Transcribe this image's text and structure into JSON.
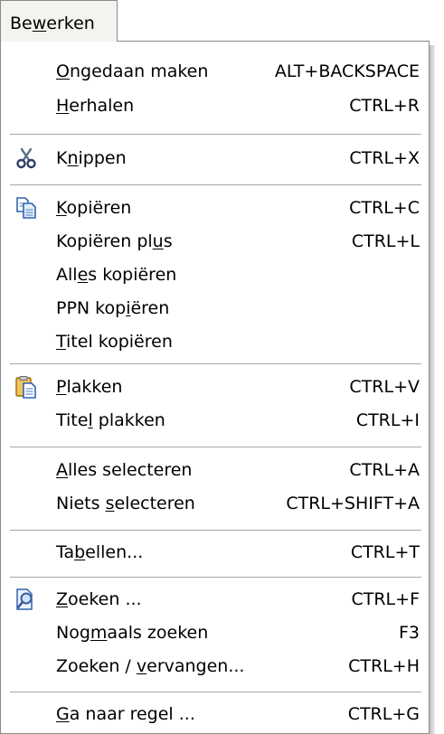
{
  "menubar": {
    "tab_label": "Bewerken"
  },
  "menu": {
    "undo": {
      "label": "Ongedaan maken",
      "shortcut": "ALT+BACKSPACE"
    },
    "redo": {
      "label": "Herhalen",
      "shortcut": "CTRL+R"
    },
    "cut": {
      "label": "Knippen",
      "shortcut": "CTRL+X",
      "icon": "scissors-icon"
    },
    "copy": {
      "label": "Kopiëren",
      "shortcut": "CTRL+C",
      "icon": "copy-icon"
    },
    "copy_plus": {
      "label": "Kopiëren plus",
      "shortcut": "CTRL+L"
    },
    "copy_all": {
      "label": "Alles kopiëren"
    },
    "copy_ppn": {
      "label": "PPN kopiëren"
    },
    "copy_title": {
      "label": "Titel kopiëren"
    },
    "paste": {
      "label": "Plakken",
      "shortcut": "CTRL+V",
      "icon": "paste-icon"
    },
    "paste_title": {
      "label": "Titel plakken",
      "shortcut": "CTRL+I"
    },
    "select_all": {
      "label": "Alles selecteren",
      "shortcut": "CTRL+A"
    },
    "select_none": {
      "label": "Niets selecteren",
      "shortcut": "CTRL+SHIFT+A"
    },
    "tables": {
      "label": "Tabellen...",
      "shortcut": "CTRL+T"
    },
    "find": {
      "label": "Zoeken ...",
      "shortcut": "CTRL+F",
      "icon": "search-icon"
    },
    "find_again": {
      "label": "Nogmaals zoeken",
      "shortcut": "F3"
    },
    "replace": {
      "label": "Zoeken / vervangen...",
      "shortcut": "CTRL+H"
    },
    "goto_line": {
      "label": "Ga naar regel ...",
      "shortcut": "CTRL+G"
    }
  },
  "colors": {
    "menu_background": "#ffffff",
    "tab_background": "#f4f3ee",
    "border": "#8a8a8a",
    "separator": "#a8a8a8"
  }
}
